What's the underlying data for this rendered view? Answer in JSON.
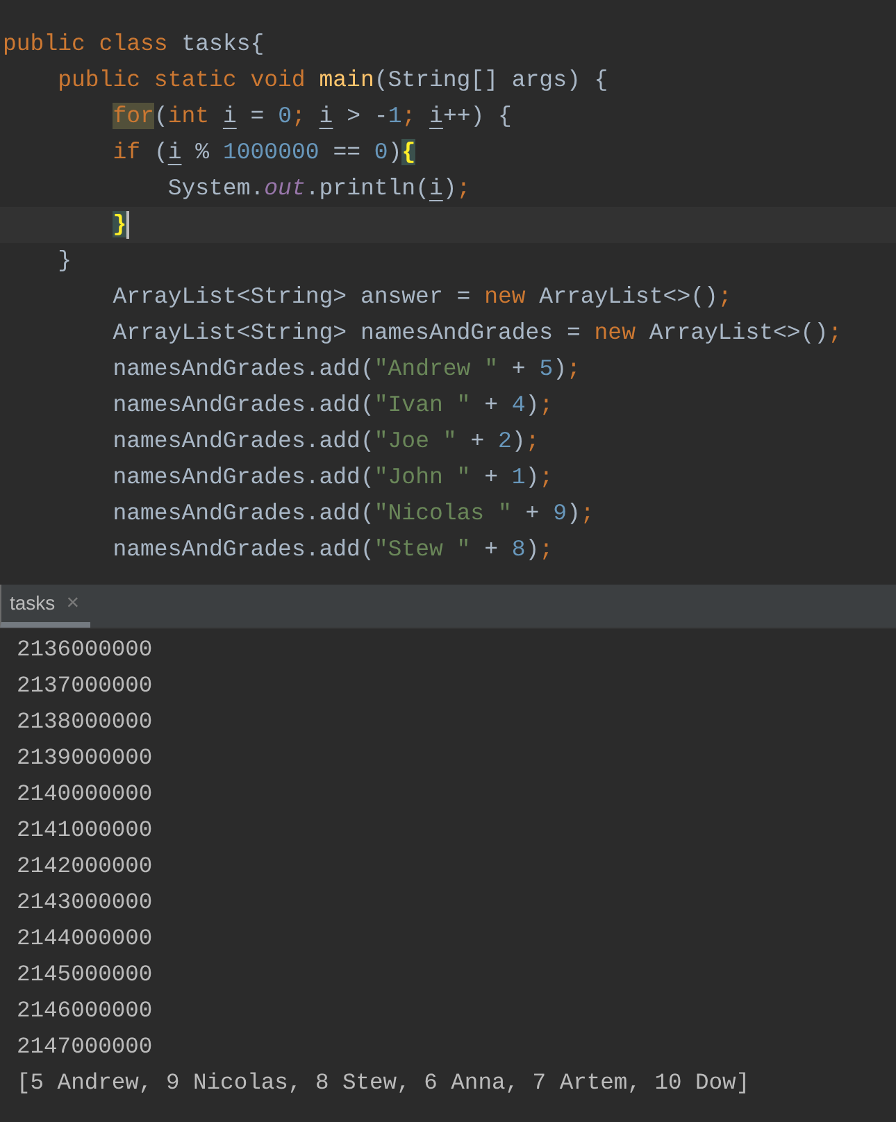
{
  "editor": {
    "lines": [
      {
        "tokens": [
          {
            "text": "public class ",
            "kind": "keyword"
          },
          {
            "text": "tasks{",
            "kind": "plain"
          }
        ]
      },
      {
        "tokens": [
          {
            "text": "    public static void ",
            "kind": "keyword"
          },
          {
            "text": "main",
            "kind": "function"
          },
          {
            "text": "(String[] args) {",
            "kind": "plain"
          }
        ]
      },
      {
        "tokens": [
          {
            "text": "        for",
            "kind": "match"
          },
          {
            "text": "(",
            "kind": "plain"
          },
          {
            "text": "int ",
            "kind": "keyword"
          },
          {
            "text": "i",
            "kind": "variable"
          },
          {
            "text": " = ",
            "kind": "plain"
          },
          {
            "text": "0",
            "kind": "number"
          },
          {
            "text": "; ",
            "kind": "keyword"
          },
          {
            "text": "i",
            "kind": "variable"
          },
          {
            "text": " > -",
            "kind": "plain"
          },
          {
            "text": "1",
            "kind": "number"
          },
          {
            "text": "; ",
            "kind": "keyword"
          },
          {
            "text": "i",
            "kind": "variable"
          },
          {
            "text": "++) {",
            "kind": "plain"
          }
        ]
      },
      {
        "tokens": [
          {
            "text": "        if ",
            "kind": "keyword"
          },
          {
            "text": "(",
            "kind": "plain"
          },
          {
            "text": "i",
            "kind": "variable"
          },
          {
            "text": " % ",
            "kind": "plain"
          },
          {
            "text": "1000000",
            "kind": "number"
          },
          {
            "text": " == ",
            "kind": "plain"
          },
          {
            "text": "0",
            "kind": "number"
          },
          {
            "text": ")",
            "kind": "plain"
          },
          {
            "text": "{",
            "kind": "brace"
          }
        ]
      },
      {
        "tokens": [
          {
            "text": "            System.",
            "kind": "plain"
          },
          {
            "text": "out",
            "kind": "field"
          },
          {
            "text": ".println(",
            "kind": "plain"
          },
          {
            "text": "i",
            "kind": "variable"
          },
          {
            "text": ")",
            "kind": "plain"
          },
          {
            "text": ";",
            "kind": "keyword"
          }
        ]
      },
      {
        "current": true,
        "caret": true,
        "tokens": [
          {
            "text": "        }",
            "kind": "brace"
          }
        ]
      },
      {
        "tokens": [
          {
            "text": "    }",
            "kind": "plain"
          }
        ]
      },
      {
        "tokens": [
          {
            "text": "        ArrayList<String> answer = ",
            "kind": "plain"
          },
          {
            "text": "new ",
            "kind": "keyword"
          },
          {
            "text": "ArrayList<>()",
            "kind": "plain"
          },
          {
            "text": ";",
            "kind": "keyword"
          }
        ]
      },
      {
        "tokens": [
          {
            "text": "        ArrayList<String> namesAndGrades = ",
            "kind": "plain"
          },
          {
            "text": "new ",
            "kind": "keyword"
          },
          {
            "text": "ArrayList<>()",
            "kind": "plain"
          },
          {
            "text": ";",
            "kind": "keyword"
          }
        ]
      },
      {
        "tokens": [
          {
            "text": "        namesAndGrades.add(",
            "kind": "plain"
          },
          {
            "text": "\"Andrew \"",
            "kind": "string"
          },
          {
            "text": " + ",
            "kind": "plain"
          },
          {
            "text": "5",
            "kind": "number"
          },
          {
            "text": ")",
            "kind": "plain"
          },
          {
            "text": ";",
            "kind": "keyword"
          }
        ]
      },
      {
        "tokens": [
          {
            "text": "        namesAndGrades.add(",
            "kind": "plain"
          },
          {
            "text": "\"Ivan \"",
            "kind": "string"
          },
          {
            "text": " + ",
            "kind": "plain"
          },
          {
            "text": "4",
            "kind": "number"
          },
          {
            "text": ")",
            "kind": "plain"
          },
          {
            "text": ";",
            "kind": "keyword"
          }
        ]
      },
      {
        "tokens": [
          {
            "text": "        namesAndGrades.add(",
            "kind": "plain"
          },
          {
            "text": "\"Joe \"",
            "kind": "string"
          },
          {
            "text": " + ",
            "kind": "plain"
          },
          {
            "text": "2",
            "kind": "number"
          },
          {
            "text": ")",
            "kind": "plain"
          },
          {
            "text": ";",
            "kind": "keyword"
          }
        ]
      },
      {
        "tokens": [
          {
            "text": "        namesAndGrades.add(",
            "kind": "plain"
          },
          {
            "text": "\"John \"",
            "kind": "string"
          },
          {
            "text": " + ",
            "kind": "plain"
          },
          {
            "text": "1",
            "kind": "number"
          },
          {
            "text": ")",
            "kind": "plain"
          },
          {
            "text": ";",
            "kind": "keyword"
          }
        ]
      },
      {
        "tokens": [
          {
            "text": "        namesAndGrades.add(",
            "kind": "plain"
          },
          {
            "text": "\"Nicolas \"",
            "kind": "string"
          },
          {
            "text": " + ",
            "kind": "plain"
          },
          {
            "text": "9",
            "kind": "number"
          },
          {
            "text": ")",
            "kind": "plain"
          },
          {
            "text": ";",
            "kind": "keyword"
          }
        ]
      },
      {
        "tokens": [
          {
            "text": "        namesAndGrades.add(",
            "kind": "plain"
          },
          {
            "text": "\"Stew \"",
            "kind": "string"
          },
          {
            "text": " + ",
            "kind": "plain"
          },
          {
            "text": "8",
            "kind": "number"
          },
          {
            "text": ")",
            "kind": "plain"
          },
          {
            "text": ";",
            "kind": "keyword"
          }
        ]
      }
    ]
  },
  "run_panel": {
    "tabs": [
      {
        "label": "tasks",
        "selected": true,
        "close": "×"
      }
    ],
    "output": [
      "2136000000",
      "2137000000",
      "2138000000",
      "2139000000",
      "2140000000",
      "2141000000",
      "2142000000",
      "2143000000",
      "2144000000",
      "2145000000",
      "2146000000",
      "2147000000",
      "[5 Andrew, 9 Nicolas, 8 Stew, 6 Anna, 7 Artem, 10 Dow]"
    ]
  }
}
